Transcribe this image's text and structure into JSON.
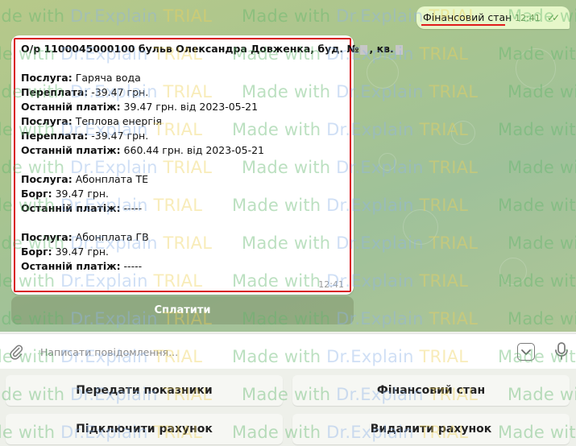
{
  "outgoing": {
    "text": "Фінансовий стан",
    "time": "12:41",
    "ticks": "✓✓"
  },
  "incoming": {
    "time": "12:41",
    "lines": [
      {
        "bold": "О/р 1100045000100 бульв Олександра Довженка, буд. №",
        "redact": true,
        "bold2": ", кв.",
        "redact2": true
      },
      {
        "blank": true
      },
      {
        "bold": "Послуга:",
        "text": " Гаряча вода"
      },
      {
        "bold": "Переплата:",
        "text": " -39.47 грн."
      },
      {
        "bold": "Останній платіж:",
        "text": " 39.47 грн. від 2023-05-21"
      },
      {
        "bold": "Послуга:",
        "text": " Теплова енергія"
      },
      {
        "bold": "Переплата:",
        "text": " -39.47 грн."
      },
      {
        "bold": "Останній платіж:",
        "text": " 660.44 грн. від 2023-05-21"
      },
      {
        "blank": true
      },
      {
        "bold": "Послуга:",
        "text": " Абонплата ТЕ"
      },
      {
        "bold": "Борг:",
        "text": " 39.47 грн."
      },
      {
        "bold": "Останній платіж:",
        "text": " -----"
      },
      {
        "blank": true
      },
      {
        "bold": "Послуга:",
        "text": " Абонплата ГВ"
      },
      {
        "bold": "Борг:",
        "text": " 39.47 грн."
      },
      {
        "bold": "Останній платіж:",
        "text": " -----"
      }
    ]
  },
  "inline_button": {
    "label": "Сплатити"
  },
  "composer": {
    "placeholder": "Написати повідомлення..."
  },
  "reply_keyboard": {
    "buttons": [
      "Передати показники",
      "Фінансовий стан",
      "Підключити рахунок",
      "Видалити рахунок"
    ]
  },
  "watermark": {
    "made": "Made with ",
    "dr": "Dr.Explain ",
    "trial": "TRIAL"
  },
  "colors": {
    "highlight": "#d8141c",
    "outgoing_bubble": "#e6f7c9",
    "tick": "#5ea14a"
  },
  "icons": {
    "attach": "paperclip-icon",
    "keyboard": "keyboard-toggle-icon",
    "voice": "microphone-icon",
    "read": "double-check-icon"
  }
}
